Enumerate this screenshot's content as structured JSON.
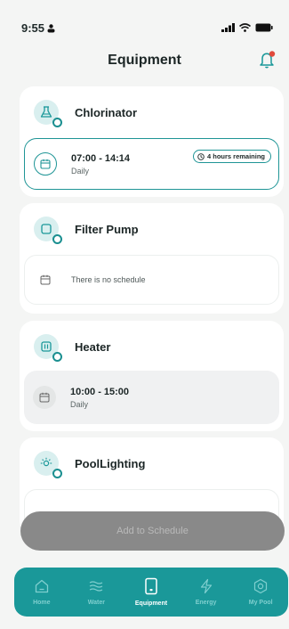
{
  "status_bar": {
    "time": "9:55"
  },
  "header": {
    "title": "Equipment"
  },
  "equipment": [
    {
      "name": "Chlorinator",
      "icon": "flask-icon",
      "schedule": {
        "time": "07:00 - 14:14",
        "repeat": "Daily",
        "remaining": "4 hours remaining"
      }
    },
    {
      "name": "Filter Pump",
      "icon": "pump-icon",
      "schedule": {
        "empty_text": "There is no schedule"
      }
    },
    {
      "name": "Heater",
      "icon": "heater-icon",
      "schedule": {
        "time": "10:00 - 15:00",
        "repeat": "Daily"
      }
    },
    {
      "name": "PoolLighting",
      "icon": "light-icon"
    }
  ],
  "actions": {
    "add_to_schedule": "Add to Schedule"
  },
  "nav": [
    {
      "label": "Home",
      "icon": "home-icon"
    },
    {
      "label": "Water",
      "icon": "water-icon"
    },
    {
      "label": "Equipment",
      "icon": "equipment-icon",
      "active": true
    },
    {
      "label": "Energy",
      "icon": "energy-icon"
    },
    {
      "label": "My Pool",
      "icon": "settings-icon"
    }
  ],
  "colors": {
    "accent": "#1a9899",
    "background": "#f4f5f4",
    "button_disabled": "#898989"
  }
}
